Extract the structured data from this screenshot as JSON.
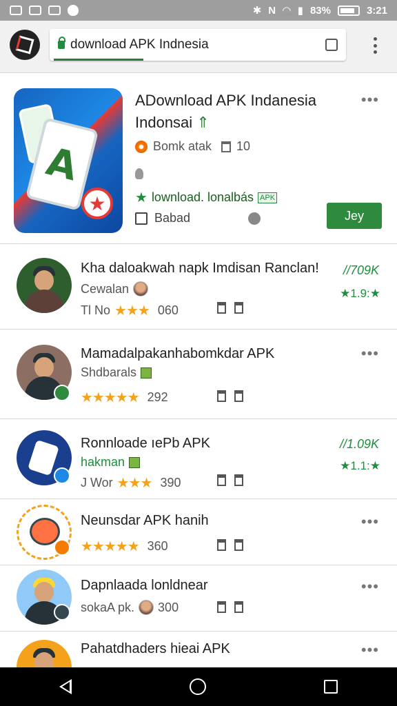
{
  "status_bar": {
    "battery": "83%",
    "time": "3:21"
  },
  "browser": {
    "url": "download APK Indnesia",
    "tab_count": ""
  },
  "featured": {
    "title_line1": "ADownload APK Indanesia",
    "title_line2": "Indonsai",
    "title_arrow": "⇑",
    "developer": "Bomk atak",
    "developer_count": "10",
    "tagline": "lownload. lonalbás",
    "tagline_badge": "APK",
    "size": "Babad",
    "install_label": "Jey",
    "more": "•••"
  },
  "items": [
    {
      "title": "Kha daloakwah napk Imdisan Ranclan!",
      "subtitle": "Cewalan",
      "rating_prefix": "Tl No",
      "stars": "★★★",
      "count": "060",
      "right_stat": "//709K",
      "right_rating": "★1.9:★"
    },
    {
      "title": "Mamadalpakanhabomkdar APK",
      "subtitle": "Shdbarals",
      "stars": "★★★★★",
      "count": "292",
      "more": "•••"
    },
    {
      "title": "Ronnloade ıePb APK",
      "subtitle": "hakman",
      "rating_prefix": "J Wor",
      "stars": "★★★",
      "count": "390",
      "right_stat": "//1.09K",
      "right_rating": "★1.1:★"
    },
    {
      "title": "Neunsdar APK hanih",
      "stars": "★★★★★",
      "count": "360",
      "more": "•••"
    },
    {
      "title": "Dapnlaada lonldnear",
      "subtitle": "sokaA pk.",
      "count": "300",
      "more": "•••"
    },
    {
      "title": "Pahatdhaders hieai APK",
      "more": "•••"
    }
  ],
  "colors": {
    "accent_green": "#2e8b3e",
    "star": "#f4a21b",
    "status_bar": "#9e9e9e"
  },
  "icons": {
    "status_left": [
      "image-icon",
      "sim-icon",
      "mail-icon",
      "notification-icon"
    ],
    "status_right": [
      "bluetooth-icon",
      "nfc-icon",
      "wifi-icon",
      "signal-icon",
      "battery-icon"
    ],
    "nav": [
      "back-icon",
      "home-icon",
      "recents-icon"
    ]
  }
}
